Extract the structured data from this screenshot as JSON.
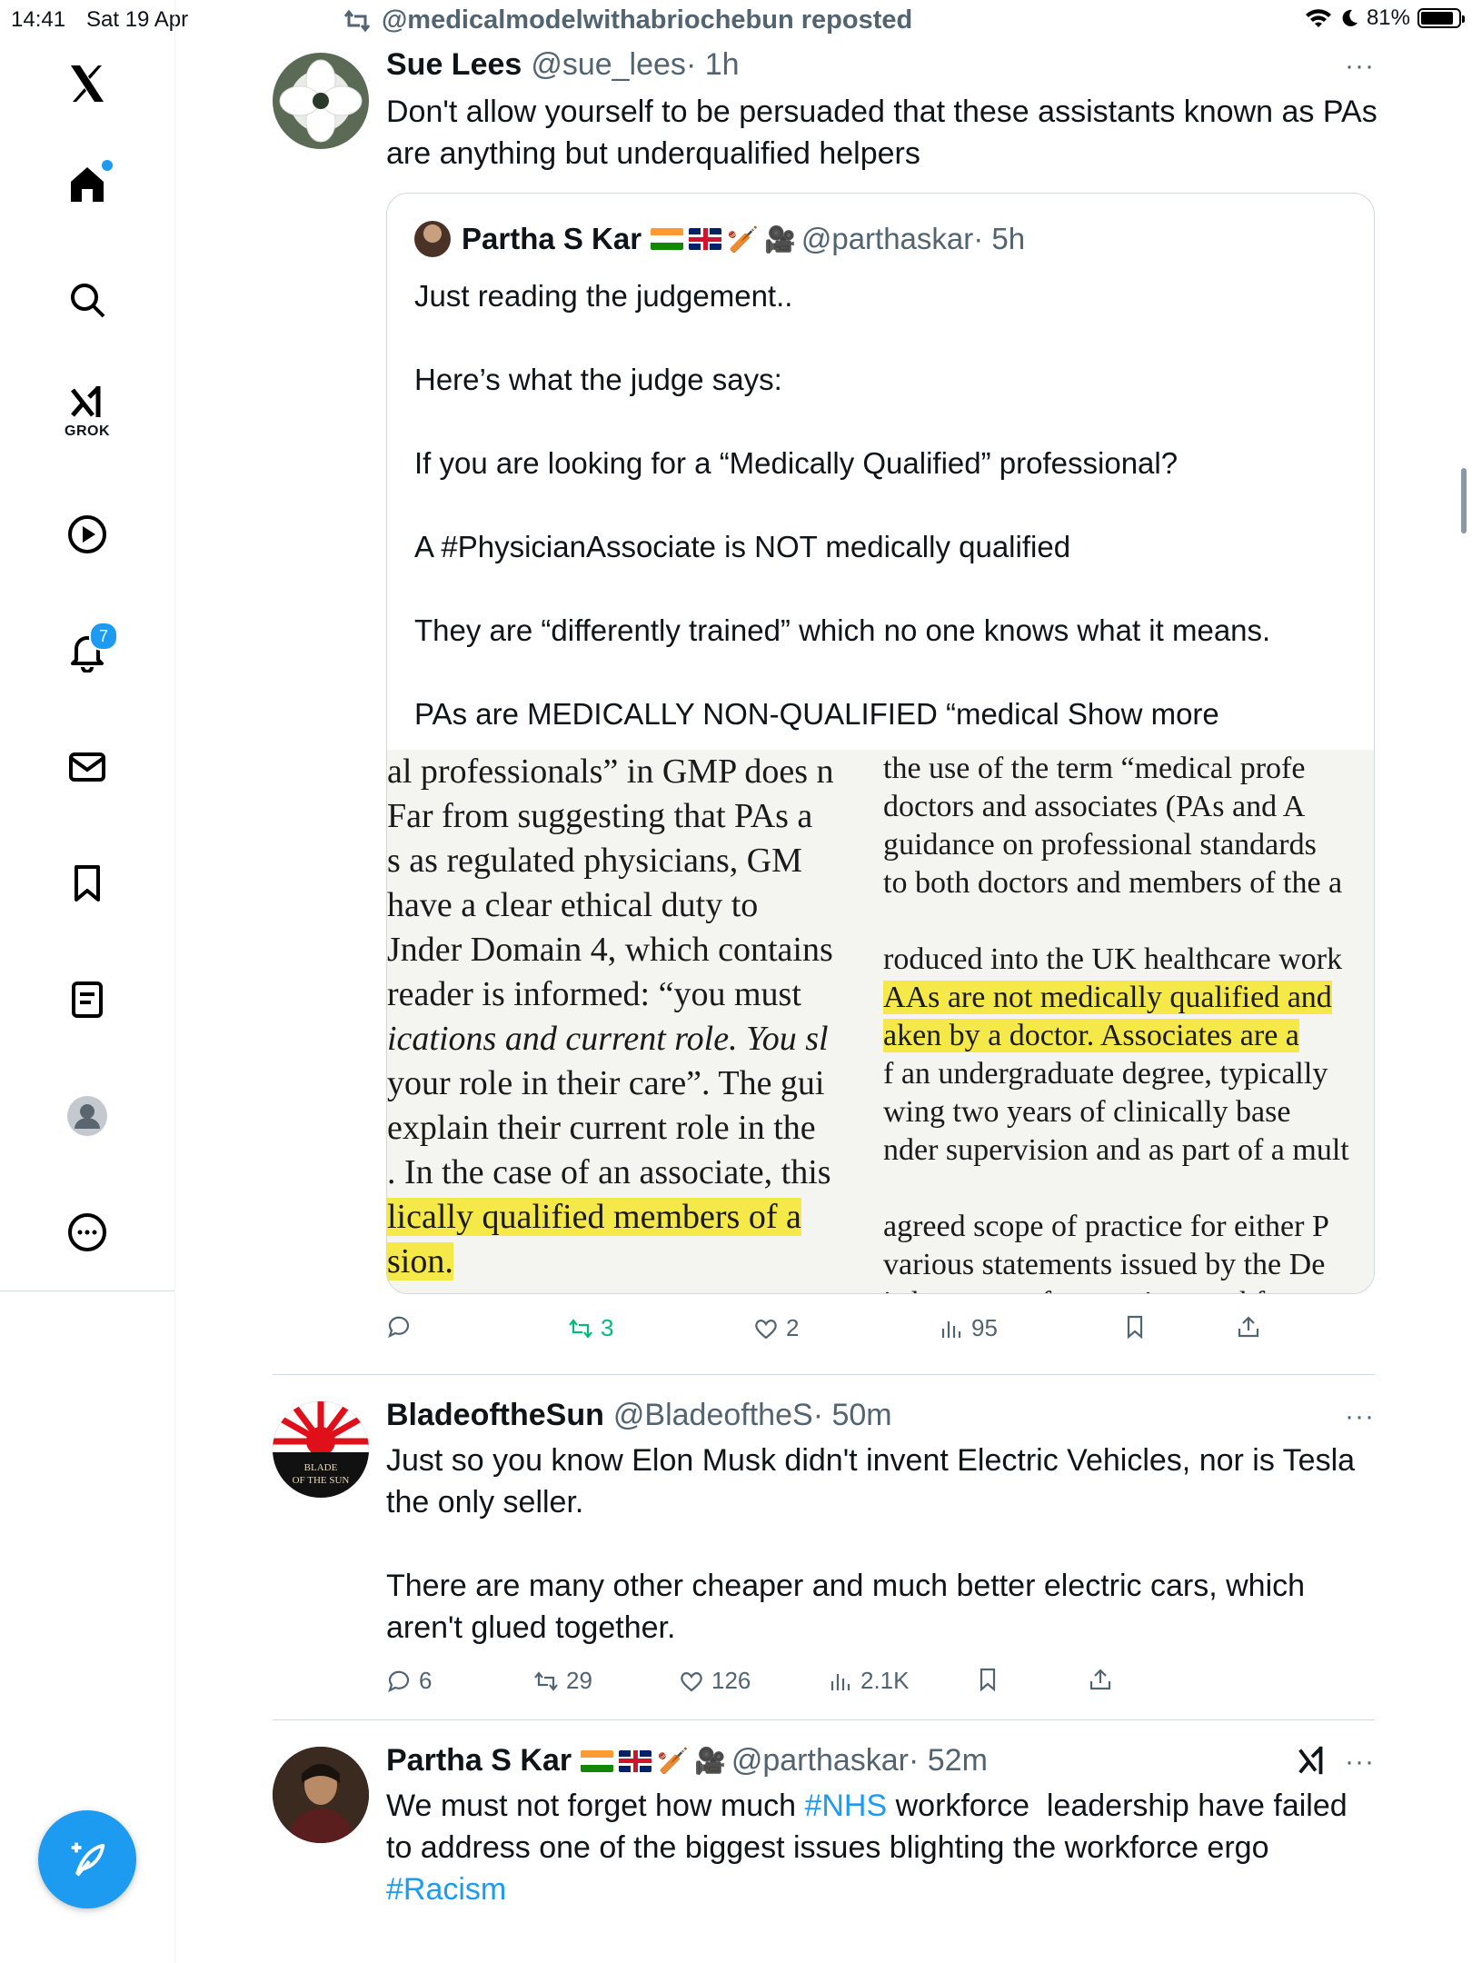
{
  "status_bar": {
    "time": "14:41",
    "date": "Sat 19 Apr",
    "battery": "81%"
  },
  "sidebar": {
    "logo": "x-logo-icon",
    "notifications_badge": "7",
    "grok_label": "GROK",
    "items": [
      "home-icon",
      "search-icon",
      "grok-icon",
      "video-icon",
      "bell-icon",
      "mail-icon",
      "bookmark-icon",
      "list-icon",
      "profile-icon",
      "more-icon"
    ]
  },
  "repost_banner": "@medicalmodelwithabriochebun reposted",
  "tweets": [
    {
      "name": "Sue Lees",
      "handle": "@sue_lees",
      "time": "· 1h",
      "text": "Don't allow yourself to be persuaded that these assistants known as PAs are anything but underqualified helpers",
      "quote": {
        "name": "Partha S Kar",
        "handle": "@parthaskar",
        "time": "· 5h",
        "text": "Just reading the judgement..\n\nHere’s what the judge says:\n\nIf you are looking for a “Medically Qualified” professional?\n\nA #PhysicianAssociate is NOT medically qualified\n\nThey are “differently trained” which no one knows what it means.\n\nPAs are MEDICALLY NON-QUALIFIED “medical ",
        "show_more": "Show more",
        "image_left": [
          "al professionals” in GMP does n",
          " Far from suggesting that PAs a",
          "s as regulated physicians, GM",
          " have a clear ethical duty to",
          "Jnder Domain 4, which contains",
          "reader is informed: “you must ",
          "ications and current role. You sl",
          "your role in their care”. The gui",
          " explain their current role in the",
          ". In the case of an associate, this",
          "lically qualified members of a",
          "sion."
        ],
        "image_right": [
          "the use of the term “medical profe",
          "doctors and associates (PAs and A",
          " guidance on professional standards",
          " to both doctors and members of the a",
          "",
          "roduced into the UK healthcare work",
          "AAs are not medically qualified and",
          "aken by a doctor.  Associates are a",
          "f an undergraduate degree, typically",
          "wing two years of clinically base",
          "nder supervision and as part of a mult",
          "",
          "agreed scope of practice for either P",
          "various statements issued by the De",
          "is however of a growing workforce"
        ]
      },
      "actions": {
        "replies": "",
        "reposts": "3",
        "likes": "2",
        "views": "95"
      }
    },
    {
      "name": "BladeoftheSun",
      "handle": "@BladeoftheS",
      "time": "· 50m",
      "avatar_text": "BLADE OF THE SUN",
      "text": "Just so you know Elon Musk didn't invent Electric Vehicles, nor is Tesla the only seller.\n\nThere are many other cheaper and much better electric cars, which aren't glued together.",
      "actions": {
        "replies": "6",
        "reposts": "29",
        "likes": "126",
        "views": "2.1K"
      }
    },
    {
      "name": "Partha S Kar",
      "handle": "@parthaskar",
      "time": "· 52m",
      "text_pre": "We must not forget how much ",
      "tag1": "#NHS",
      "text_mid": " workforce  leadership have failed to address one of the biggest issues blighting the workforce ergo ",
      "tag2": "#Racism"
    }
  ],
  "more_label": "···",
  "colors": {
    "accent": "#1d9bf0",
    "muted": "#536471",
    "repost_green": "#00ba7c",
    "highlight": "#f5e94a"
  }
}
